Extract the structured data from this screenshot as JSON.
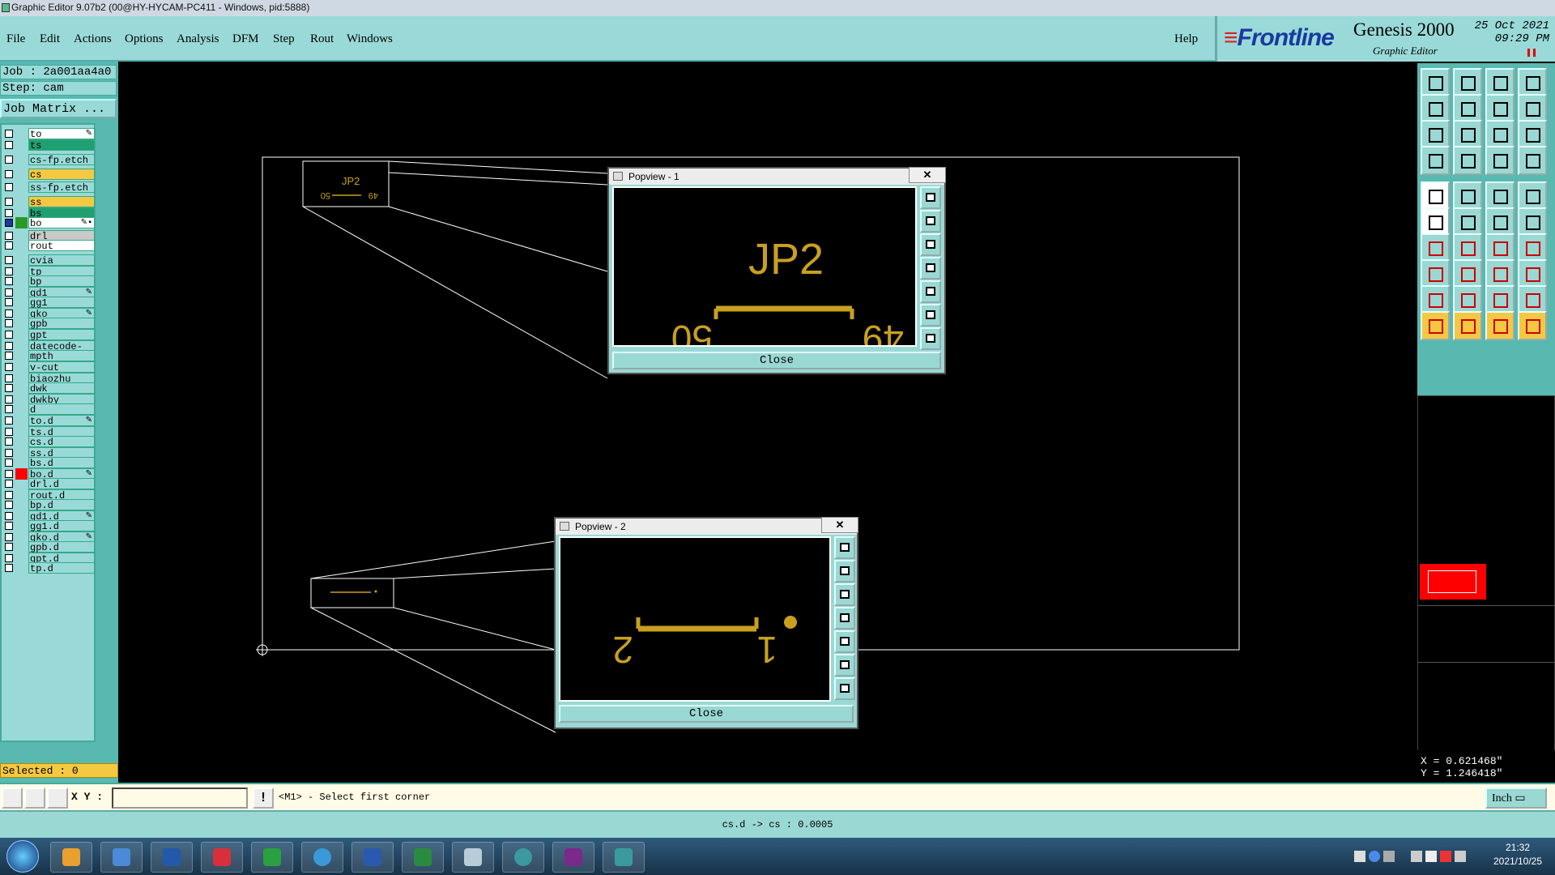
{
  "window": {
    "title": "Graphic Editor 9.07b2 (00@HY-HYCAM-PC411 - Windows, pid:5888)"
  },
  "menu": {
    "items": [
      "File",
      "Edit",
      "Actions",
      "Options",
      "Analysis",
      "DFM",
      "Step",
      "Rout",
      "Windows"
    ],
    "help": "Help"
  },
  "brand": {
    "logo": "Frontline",
    "product": "Genesis 2000",
    "subtitle": "Graphic Editor",
    "date": "25 Oct 2021",
    "time": "09:29 PM"
  },
  "job": {
    "job_label": "Job : 2a001aa4a0",
    "step_label": "Step: cam",
    "matrix_button": "Job Matrix ..."
  },
  "layers": [
    {
      "name": "to",
      "style": "white",
      "mark": "✎"
    },
    {
      "name": "ts",
      "style": "green"
    },
    {
      "name": "cs-fp.etch",
      "style": ""
    },
    {
      "name": "cs",
      "style": "yellow"
    },
    {
      "name": "ss-fp.etch",
      "style": ""
    },
    {
      "name": "ss",
      "style": "yellow"
    },
    {
      "name": "bs",
      "style": "green"
    },
    {
      "name": "bo",
      "style": "white",
      "mark": "✎▪",
      "swatch": "#2a9a2a",
      "checked": true
    },
    {
      "name": "drl",
      "style": "gray"
    },
    {
      "name": "rout",
      "style": "white"
    },
    {
      "name": "cvia",
      "style": ""
    },
    {
      "name": "tp",
      "style": ""
    },
    {
      "name": "bp",
      "style": ""
    },
    {
      "name": "gd1",
      "style": "",
      "mark": "✎"
    },
    {
      "name": "gg1",
      "style": ""
    },
    {
      "name": "gko",
      "style": "",
      "mark": "✎"
    },
    {
      "name": "gpb",
      "style": ""
    },
    {
      "name": "gpt",
      "style": ""
    },
    {
      "name": "datecode-to",
      "style": ""
    },
    {
      "name": "mpth",
      "style": ""
    },
    {
      "name": "v-cut",
      "style": ""
    },
    {
      "name": "biaozhu",
      "style": ""
    },
    {
      "name": "dwk",
      "style": ""
    },
    {
      "name": "dwkby",
      "style": ""
    },
    {
      "name": "d",
      "style": ""
    },
    {
      "name": "to.d",
      "style": "",
      "mark": "✎"
    },
    {
      "name": "ts.d",
      "style": ""
    },
    {
      "name": "cs.d",
      "style": ""
    },
    {
      "name": "ss.d",
      "style": ""
    },
    {
      "name": "bs.d",
      "style": ""
    },
    {
      "name": "bo.d",
      "style": "",
      "mark": "✎",
      "swatch": "#ff0000"
    },
    {
      "name": "drl.d",
      "style": ""
    },
    {
      "name": "rout.d",
      "style": ""
    },
    {
      "name": "bp.d",
      "style": ""
    },
    {
      "name": "gd1.d",
      "style": "",
      "mark": "✎"
    },
    {
      "name": "gg1.d",
      "style": ""
    },
    {
      "name": "gko.d",
      "style": "",
      "mark": "✎"
    },
    {
      "name": "gpb.d",
      "style": ""
    },
    {
      "name": "gpt.d",
      "style": ""
    },
    {
      "name": "tp.d",
      "style": ""
    }
  ],
  "selected": "Selected : 0",
  "popview1": {
    "title": "Popview - 1",
    "close_x": "✕",
    "label_main": "JP2",
    "label_left": "50",
    "label_right": "49",
    "close_button": "Close"
  },
  "popview2": {
    "title": "Popview - 2",
    "close_x": "✕",
    "label_left": "2",
    "label_right": "1",
    "close_button": "Close"
  },
  "thumb1": {
    "label_main": "JP2",
    "label_left": "50",
    "label_right": "49"
  },
  "coords": {
    "x": "X = 0.621468\"",
    "y": "Y = 1.246418\""
  },
  "status": {
    "xy_label": "X Y :",
    "xy_value": "",
    "prompt": "<M1> - Select first corner",
    "units": "Inch ▭"
  },
  "info": "cs.d -> cs : 0.0005",
  "taskbar": {
    "time": "21:32",
    "date": "2021/10/25"
  },
  "colors": {
    "accent": "#99dad8",
    "panel": "#59b8b0",
    "highlight": "#f5c842",
    "pad_gold": "#c8a020"
  }
}
